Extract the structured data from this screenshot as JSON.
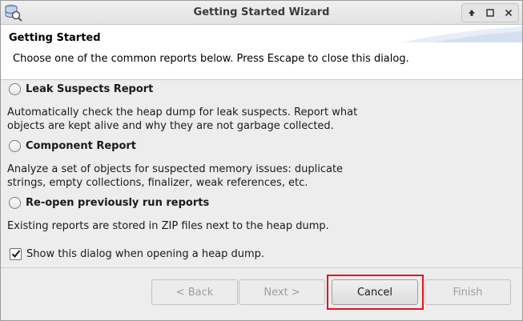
{
  "window": {
    "title": "Getting Started Wizard",
    "icon": "heap-database-search-icon",
    "controls": [
      "up-arrow-icon",
      "maximize-icon",
      "close-icon"
    ]
  },
  "header": {
    "title": "Getting Started",
    "description": "Choose one of the common reports below. Press Escape to close this dialog."
  },
  "options": [
    {
      "label": "Leak Suspects Report",
      "selected": false,
      "description_line1": "Automatically check the heap dump for leak suspects. Report what",
      "description_line2": "objects are kept alive and why they are not garbage collected."
    },
    {
      "label": "Component Report",
      "selected": false,
      "description_line1": "Analyze a set of objects for suspected memory issues: duplicate",
      "description_line2": "strings, empty collections, finalizer, weak references, etc."
    },
    {
      "label": "Re-open previously run reports",
      "selected": false,
      "description_line1": "Existing reports are stored in ZIP files next to the heap dump.",
      "description_line2": ""
    }
  ],
  "show_dialog_checkbox": {
    "label": "Show this dialog when opening a heap dump.",
    "checked": true
  },
  "buttons": {
    "back": "< Back",
    "next": "Next >",
    "cancel": "Cancel",
    "finish": "Finish"
  },
  "colors": {
    "highlight": "#e0141e",
    "disabled_text": "#9d9d9d"
  }
}
